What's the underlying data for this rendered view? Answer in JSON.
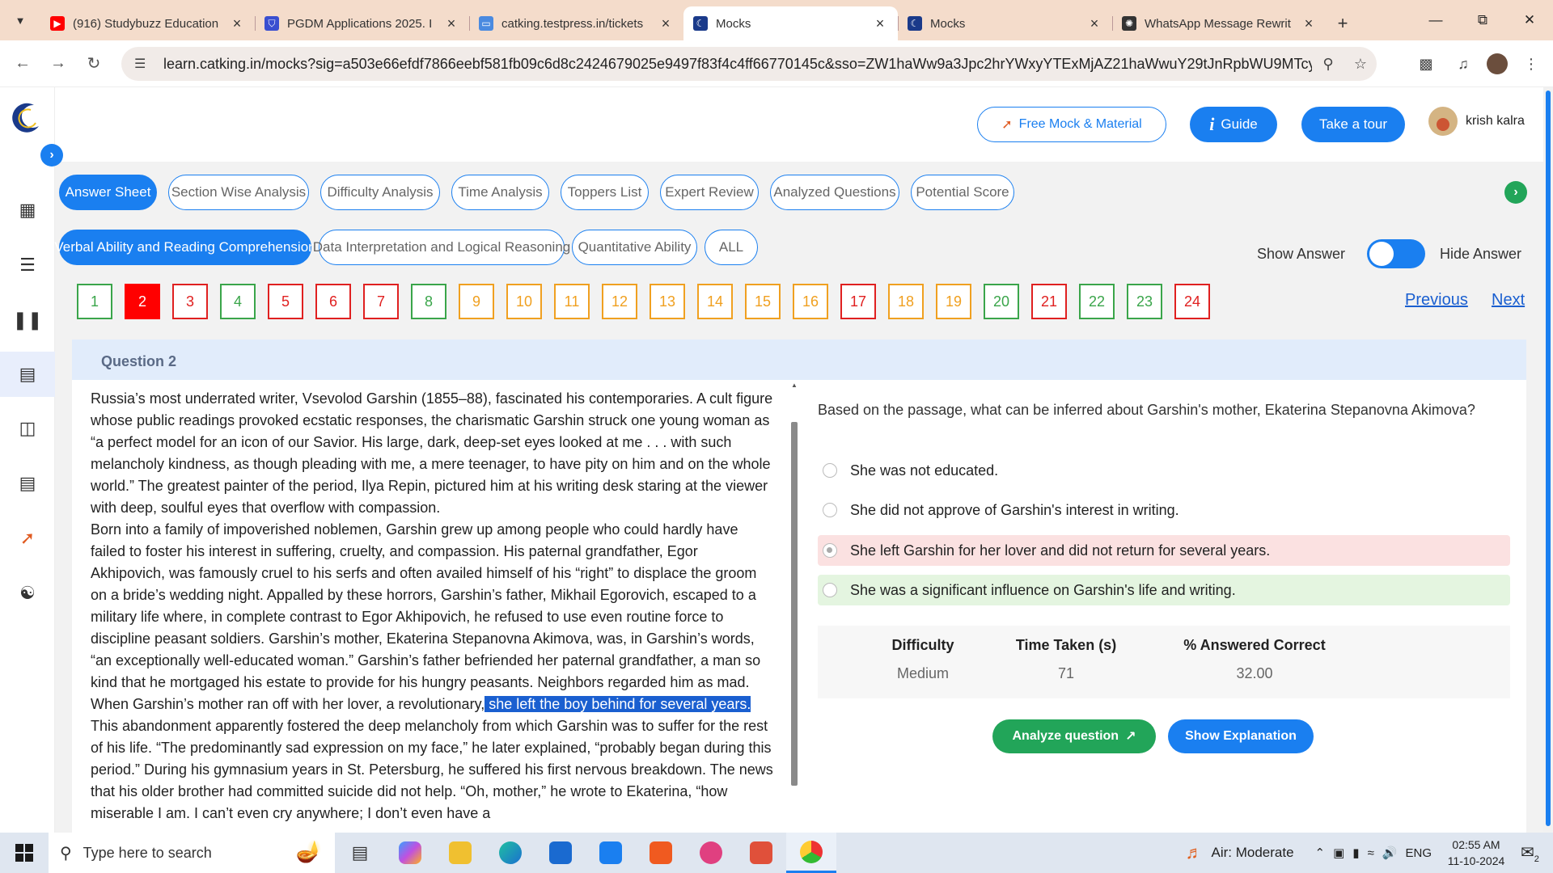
{
  "browser": {
    "tabs": [
      {
        "title": "(916) Studybuzz Education",
        "icon": "youtube-icon",
        "color": "#ff0000",
        "active": false
      },
      {
        "title": "PGDM Applications 2025. I",
        "icon": "shield-icon",
        "color": "#3a4fd0",
        "active": false
      },
      {
        "title": "catking.testpress.in/tickets",
        "icon": "page-icon",
        "color": "#4a8ae0",
        "active": false
      },
      {
        "title": "Mocks",
        "icon": "catking-icon",
        "color": "#1a3a8a",
        "active": true
      },
      {
        "title": "Mocks",
        "icon": "catking-icon",
        "color": "#1a3a8a",
        "active": false
      },
      {
        "title": "WhatsApp Message Rewrit",
        "icon": "chatgpt-icon",
        "color": "#333333",
        "active": false
      }
    ],
    "url": "learn.catking.in/mocks?sig=a503e66efdf7866eebf581fb09c6d8c2424679025e9497f83f4c4ff66770145c&sso=ZW1haWw9a3Jpc2hrYWxyYTExMjAZ21haWwuY29tJnRpbWU9MTcyODU..."
  },
  "header": {
    "free_mock": "Free Mock & Material",
    "guide": "Guide",
    "tour": "Take a tour",
    "user_name": "krish kalra"
  },
  "analysis_tabs": [
    "Answer Sheet",
    "Section Wise Analysis",
    "Difficulty Analysis",
    "Time Analysis",
    "Toppers List",
    "Expert Review",
    "Analyzed Questions",
    "Potential Score"
  ],
  "section_tabs": [
    "Verbal Ability and Reading Comprehension",
    "Data Interpretation and Logical Reasoning",
    "Quantitative Ability",
    "ALL"
  ],
  "toggle": {
    "show": "Show Answer",
    "hide": "Hide Answer"
  },
  "questions": [
    {
      "n": "1",
      "s": "g"
    },
    {
      "n": "2",
      "s": "cur"
    },
    {
      "n": "3",
      "s": "r"
    },
    {
      "n": "4",
      "s": "g"
    },
    {
      "n": "5",
      "s": "r"
    },
    {
      "n": "6",
      "s": "r"
    },
    {
      "n": "7",
      "s": "r"
    },
    {
      "n": "8",
      "s": "g"
    },
    {
      "n": "9",
      "s": "o"
    },
    {
      "n": "10",
      "s": "o"
    },
    {
      "n": "11",
      "s": "o"
    },
    {
      "n": "12",
      "s": "o"
    },
    {
      "n": "13",
      "s": "o"
    },
    {
      "n": "14",
      "s": "o"
    },
    {
      "n": "15",
      "s": "o"
    },
    {
      "n": "16",
      "s": "o"
    },
    {
      "n": "17",
      "s": "r"
    },
    {
      "n": "18",
      "s": "o"
    },
    {
      "n": "19",
      "s": "o"
    },
    {
      "n": "20",
      "s": "g"
    },
    {
      "n": "21",
      "s": "r"
    },
    {
      "n": "22",
      "s": "g"
    },
    {
      "n": "23",
      "s": "g"
    },
    {
      "n": "24",
      "s": "r"
    }
  ],
  "pager": {
    "previous": "Previous",
    "next": "Next"
  },
  "question": {
    "heading": "Question 2",
    "passage": [
      [
        "Russia’s most underrated writer, Vsevolod Garshin (1855–88), fascinated his contemporaries. A cult figure whose public readings provoked ecstatic responses, the charismatic Garshin struck one young woman as “a perfect model for an icon of our Savior. His large, dark, deep-set eyes looked at me . . . with such melancholy kindness, as though pleading with me, a mere teenager, to have pity on him and on the whole world.” The greatest painter of the period, Ilya Repin, pictured him at his writing desk staring at the viewer with deep, soulful eyes that overflow with compassion."
      ],
      [
        "Born into a family of impoverished noblemen, Garshin grew up among people who could hardly have failed to foster his interest in suffering, cruelty, and compassion. His paternal grandfather, Egor Akhipovich, was famously cruel to his serfs and often availed himself of his “right” to displace the groom on a bride’s wedding night. Appalled by these horrors, Garshin’s father, Mikhail Egorovich, escaped to a military life where, in complete contrast to Egor Akhipovich, he refused to use even routine force to discipline peasant soldiers. Garshin’s mother, Ekaterina Stepanovna Akimova, was, in Garshin’s words, “an exceptionally well-educated woman.” Garshin’s father befriended her paternal grandfather, a man so kind that he mortgaged his estate to provide for his hungry peasants. Neighbors regarded him as mad."
      ],
      [
        "When Garshin’s mother ran off with her lover, a revolutionary,",
        " she left the boy behind for several years.",
        " This abandonment apparently fostered the deep melancholy from which Garshin was to suffer for the rest of his life. “The predominantly sad expression on my face,” he later explained, “probably began during this period.” During his gymnasium years in St. Petersburg, he suffered his first nervous breakdown. The news that his older brother had committed suicide did not help. “Oh, mother,” he wrote to Ekaterina, “how miserable I am. I can’t even cry anywhere; I don’t even have a"
      ]
    ],
    "prompt": "Based on the passage, what can be inferred about Garshin's mother, Ekaterina Stepanovna Akimova?",
    "options": [
      {
        "text": "She was not educated.",
        "state": "none"
      },
      {
        "text": "She did not approve of Garshin's interest in writing.",
        "state": "none"
      },
      {
        "text": "She left Garshin for her lover and did not return for several years.",
        "state": "wrong"
      },
      {
        "text": "She was a significant influence on Garshin's life and writing.",
        "state": "right"
      }
    ],
    "stats": {
      "difficulty_label": "Difficulty",
      "difficulty": "Medium",
      "time_label": "Time Taken (s)",
      "time": "71",
      "correct_label": "% Answered Correct",
      "correct": "32.00"
    },
    "analyze": "Analyze question",
    "explain": "Show Explanation"
  },
  "taskbar": {
    "search_placeholder": "Type here to search",
    "weather": "Air: Moderate",
    "lang": "ENG",
    "time": "02:55 AM",
    "date": "11-10-2024",
    "notif": "2"
  },
  "colors": {
    "accent": "#1a7ff0",
    "green": "#22a559",
    "wrong_bg": "#fbe1e1",
    "right_bg": "#e4f5e0"
  }
}
